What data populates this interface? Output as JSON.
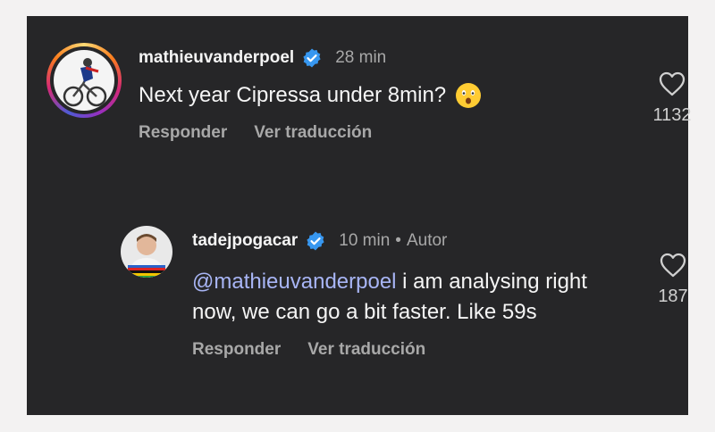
{
  "comments": [
    {
      "username": "mathieuvanderpoel",
      "verified": true,
      "time": "28 min",
      "text": "Next year Cipressa under 8min?",
      "emoji": "astonished-face",
      "actions": {
        "reply": "Responder",
        "translate": "Ver traducción"
      },
      "likes": "1132"
    },
    {
      "username": "tadejpogacar",
      "verified": true,
      "time": "10 min",
      "separator": "•",
      "author_label": "Autor",
      "mention": "@mathieuvanderpoel",
      "text": " i am analysing right now, we can go a bit faster. Like 59s",
      "actions": {
        "reply": "Responder",
        "translate": "Ver traducción"
      },
      "likes": "187"
    }
  ],
  "colors": {
    "background": "#262628",
    "text": "#f5f5f5",
    "muted": "#a8a8a8",
    "mention": "#a8b5f5",
    "verified": "#3797f0"
  }
}
